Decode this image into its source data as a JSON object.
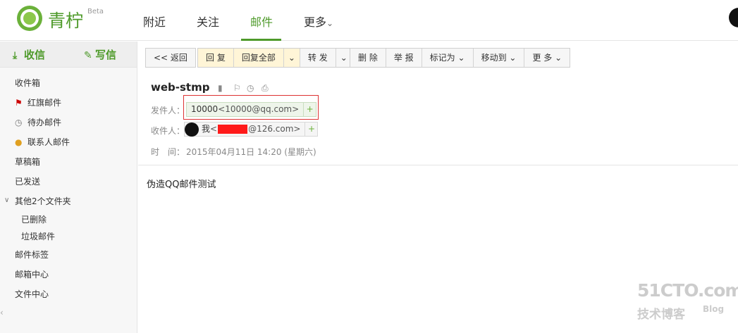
{
  "brand": {
    "name": "青柠",
    "beta": "Beta"
  },
  "nav": {
    "nearby": "附近",
    "follow": "关注",
    "mail": "邮件",
    "more": "更多",
    "more_caret": "⌄"
  },
  "sidebar": {
    "receive": "收信",
    "compose": "写信",
    "items": {
      "inbox": "收件箱",
      "flagged": "红旗邮件",
      "todo": "待办邮件",
      "contacts": "联系人邮件",
      "drafts": "草稿箱",
      "sent": "已发送",
      "other_folders": "其他2个文件夹",
      "deleted": "已删除",
      "spam": "垃圾邮件",
      "tags": "邮件标签",
      "center": "邮箱中心",
      "files": "文件中心"
    }
  },
  "toolbar": {
    "back": "<< 返回",
    "reply": "回 复",
    "reply_all": "回复全部",
    "forward": "转 发",
    "delete": "删 除",
    "report": "举 报",
    "mark_as": "标记为",
    "move_to": "移动到",
    "more": "更 多",
    "caret": "⌄"
  },
  "mail": {
    "subject": "web-stmp",
    "from_label": "发件人：",
    "from_name": "10000",
    "from_addr": "<10000@qq.com>",
    "to_label": "收件人：",
    "to_name": "我",
    "to_addr_prefix": "<",
    "to_addr_suffix": "@126.com>",
    "time_label": "时　间：",
    "time_value": "2015年04月11日 14:20 (星期六)",
    "body": "伪造QQ邮件测试",
    "plus": "+"
  },
  "watermark": {
    "line1": "51CTO.com",
    "line2": "技术博客",
    "line3": "Blog"
  }
}
